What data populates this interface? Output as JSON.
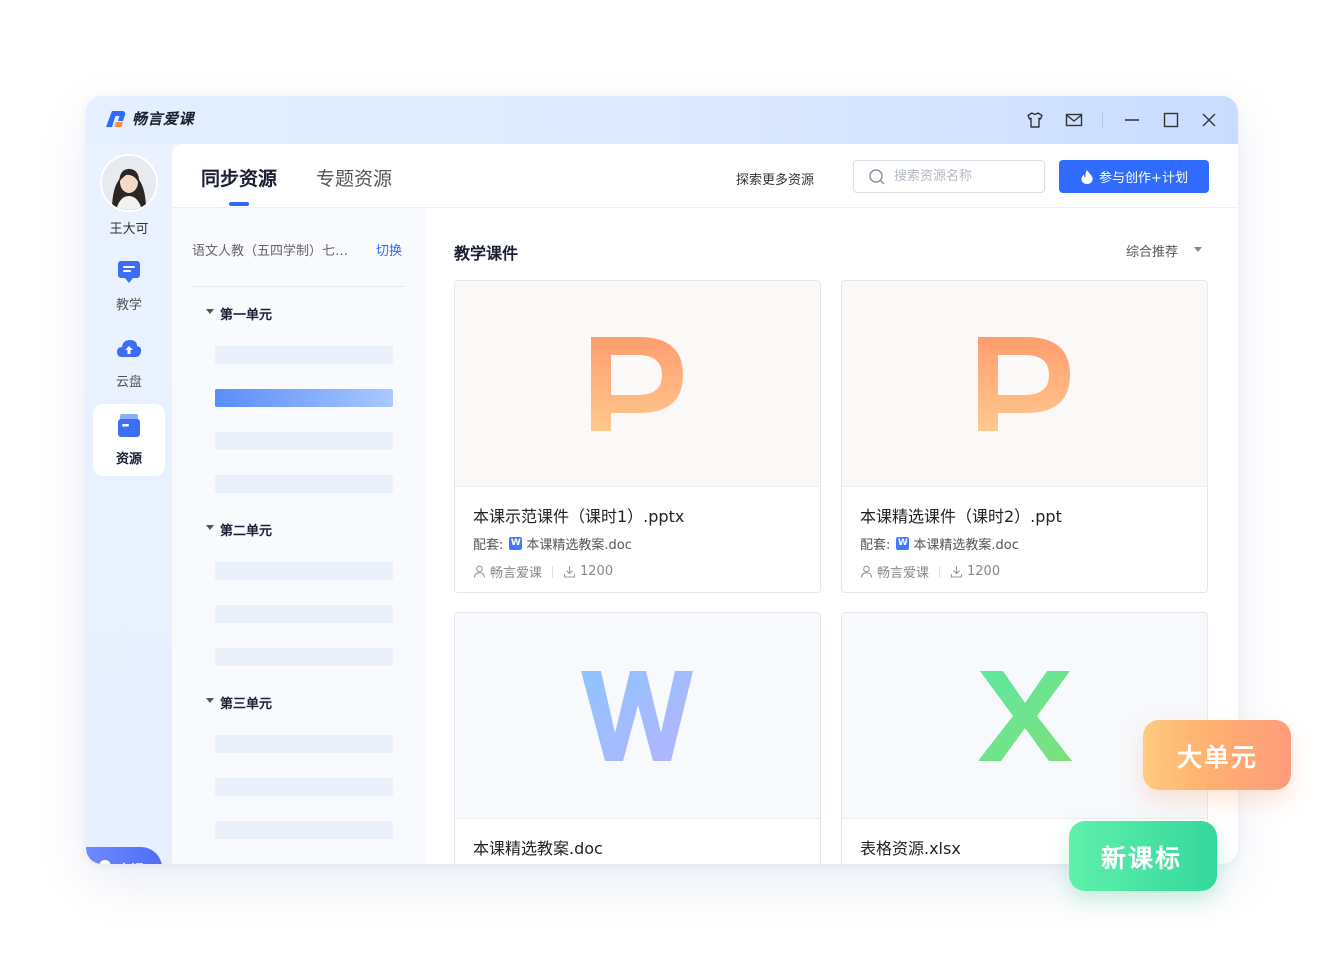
{
  "app": {
    "name": "畅言爱课",
    "brand_color": "#2f6bff"
  },
  "titlebar": {
    "icons": [
      "shirt-icon",
      "mail-icon",
      "minimize-icon",
      "maximize-icon",
      "close-icon"
    ]
  },
  "sidenav": {
    "user_name": "王大可",
    "items": [
      {
        "label": "教学",
        "icon": "teaching-icon"
      },
      {
        "label": "云盘",
        "icon": "cloud-upload-icon"
      },
      {
        "label": "资源",
        "icon": "resource-box-icon",
        "active": true
      }
    ],
    "class_button": "上课"
  },
  "header": {
    "tabs": [
      {
        "label": "同步资源",
        "active": true
      },
      {
        "label": "专题资源"
      }
    ],
    "explore_link": "探索更多资源",
    "search_placeholder": "搜索资源名称",
    "create_button": "参与创作+计划"
  },
  "sidebar": {
    "grade": "语文人教（五四学制）七…",
    "switch_label": "切换",
    "units": [
      {
        "title": "第一单元",
        "lessons": 4,
        "active_lesson": 2
      },
      {
        "title": "第二单元",
        "lessons": 3
      },
      {
        "title": "第三单元",
        "lessons": 3
      }
    ]
  },
  "content": {
    "section_title": "教学课件",
    "sort_label": "综合推荐",
    "cards": [
      {
        "type": "P",
        "file_name": "本课示范课件（课时1）.pptx",
        "match_label": "配套:",
        "match_file": "本课精选教案.doc",
        "author": "畅言爱课",
        "downloads": "1200"
      },
      {
        "type": "P",
        "file_name": "本课精选课件（课时2）.ppt",
        "match_label": "配套:",
        "match_file": "本课精选教案.doc",
        "author": "畅言爱课",
        "downloads": "1200"
      },
      {
        "type": "W",
        "file_name": "本课精选教案.doc"
      },
      {
        "type": "X",
        "file_name": "表格资源.xlsx"
      }
    ]
  },
  "promo": {
    "big_unit": "大单元",
    "new_standard": "新课标"
  }
}
